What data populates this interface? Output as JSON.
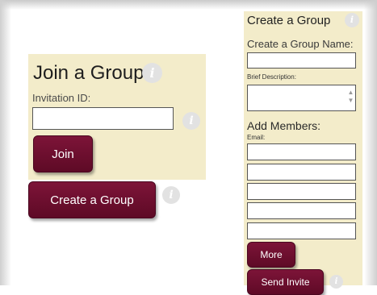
{
  "join_group": {
    "title": "Join a Group",
    "invitation_label": "Invitation ID:",
    "invitation_value": "",
    "join_button": "Join"
  },
  "create_group_button": "Create a Group",
  "create_group": {
    "title": "Create a Group",
    "name_label": "Create a Group Name:",
    "name_value": "",
    "description_label": "Brief Description:",
    "description_value": "",
    "add_members_label": "Add Members:",
    "email_label": "Email:",
    "emails": [
      "",
      "",
      "",
      "",
      ""
    ],
    "more_button": "More",
    "send_button": "Send Invite"
  },
  "info_glyph": "i",
  "colors": {
    "panel_background": "#f3ecca",
    "button_maroon": "#6d0f30",
    "info_icon_gray": "#e2e2e2"
  }
}
